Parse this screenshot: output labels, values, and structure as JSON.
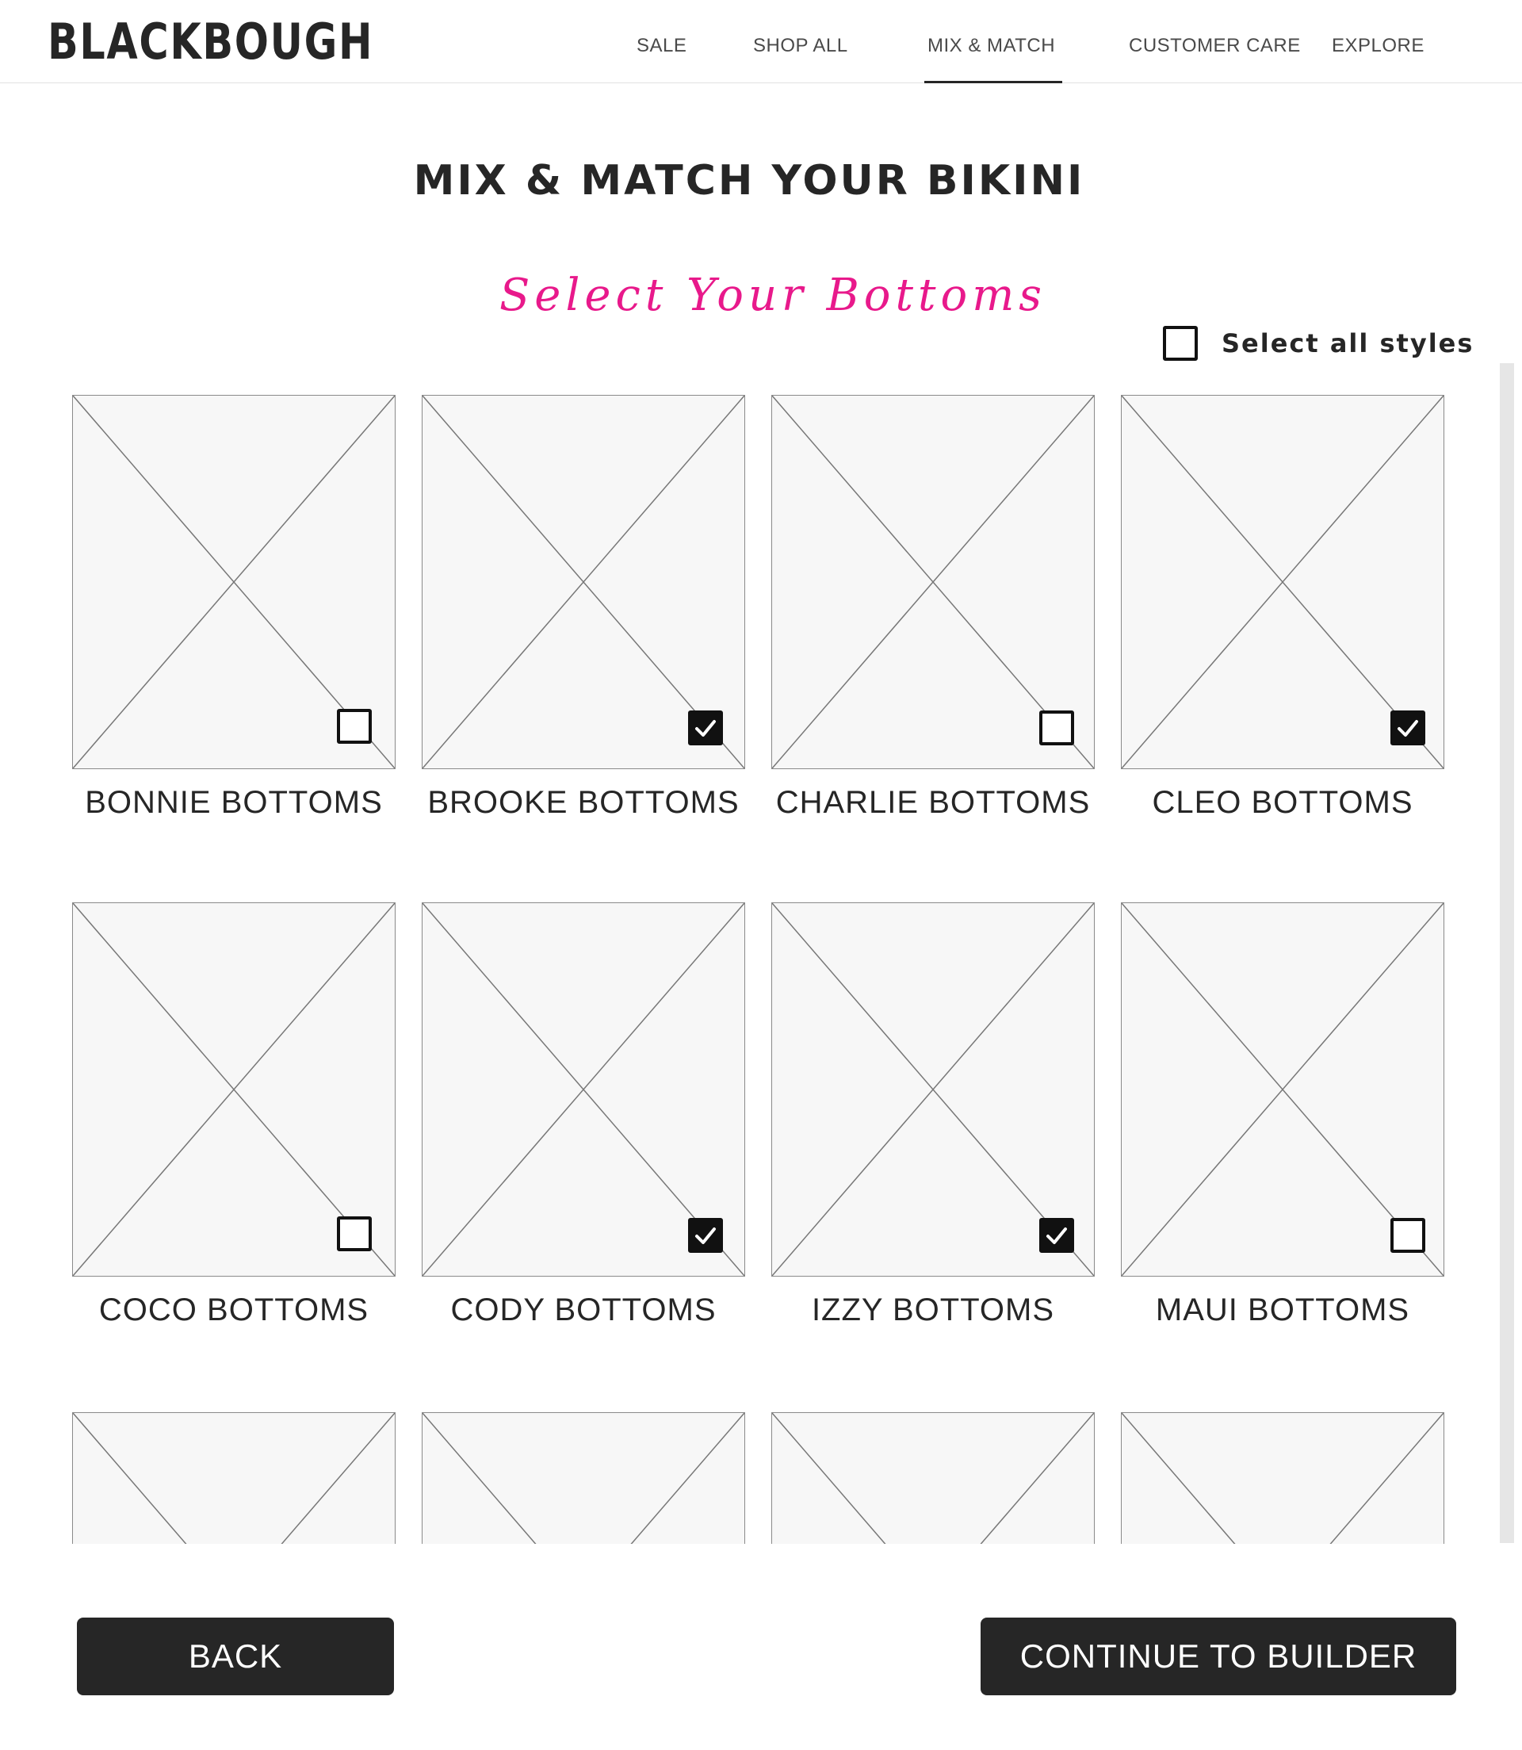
{
  "header": {
    "logo": "BLACKBOUGH",
    "nav": [
      {
        "label": "SALE",
        "active": false
      },
      {
        "label": "SHOP ALL",
        "active": false
      },
      {
        "label": "MIX & MATCH",
        "active": true
      },
      {
        "label": "CUSTOMER CARE",
        "active": false
      },
      {
        "label": "EXPLORE",
        "active": false
      }
    ]
  },
  "main": {
    "title": "MIX & MATCH YOUR BIKINI",
    "subtitle": "Select Your Bottoms",
    "select_all": {
      "label": "Select all styles",
      "checked": false
    }
  },
  "products": [
    {
      "name": "BONNIE BOTTOMS",
      "selected": false
    },
    {
      "name": "BROOKE BOTTOMS",
      "selected": true
    },
    {
      "name": "CHARLIE BOTTOMS",
      "selected": false
    },
    {
      "name": "CLEO BOTTOMS",
      "selected": true
    },
    {
      "name": "COCO BOTTOMS",
      "selected": false
    },
    {
      "name": "CODY BOTTOMS",
      "selected": true
    },
    {
      "name": "IZZY BOTTOMS",
      "selected": true
    },
    {
      "name": "MAUI BOTTOMS",
      "selected": false
    },
    {
      "name": "",
      "selected": false
    },
    {
      "name": "",
      "selected": false
    },
    {
      "name": "",
      "selected": false
    },
    {
      "name": "",
      "selected": false
    }
  ],
  "footer": {
    "back_label": "BACK",
    "continue_label": "CONTINUE TO BUILDER"
  },
  "colors": {
    "accent": "#e8198b",
    "button_bg": "#262626",
    "text": "#262626"
  }
}
